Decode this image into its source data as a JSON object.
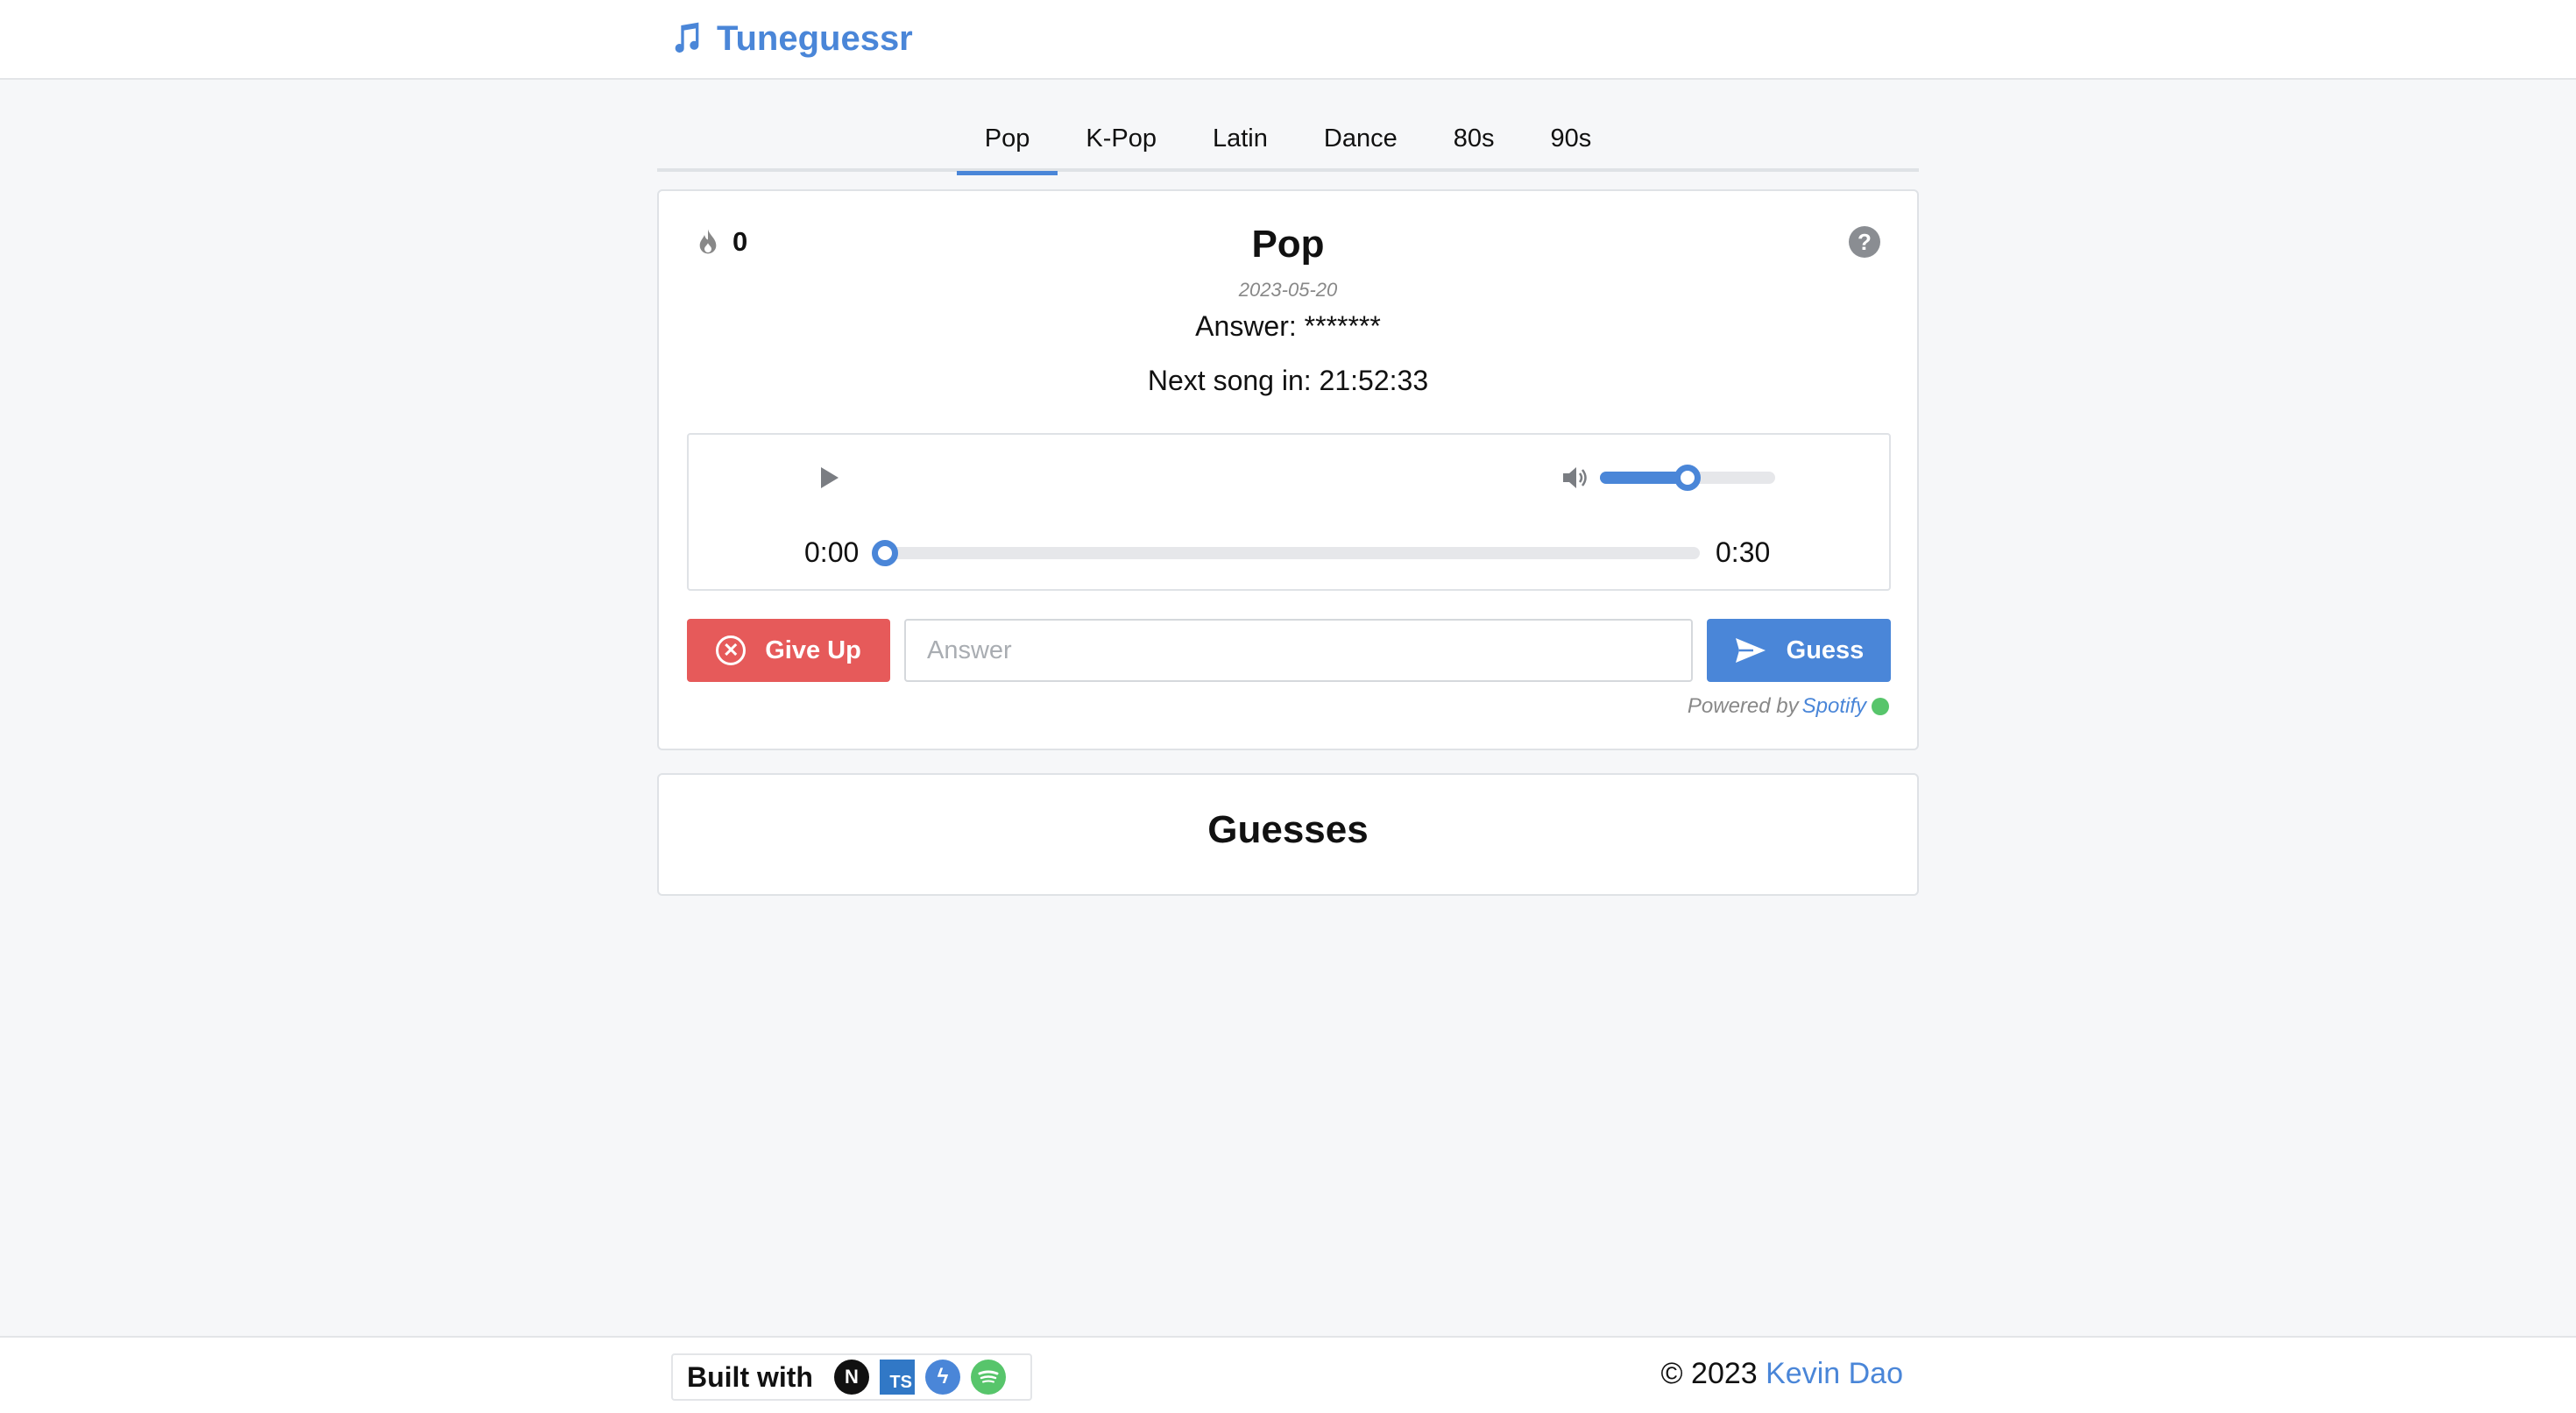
{
  "header": {
    "brand": "Tuneguessr",
    "brand_icon": "music-note-icon",
    "accent_color": "#4a86d8"
  },
  "tabs": [
    {
      "label": "Pop",
      "active": true
    },
    {
      "label": "K-Pop",
      "active": false
    },
    {
      "label": "Latin",
      "active": false
    },
    {
      "label": "Dance",
      "active": false
    },
    {
      "label": "80s",
      "active": false
    },
    {
      "label": "90s",
      "active": false
    }
  ],
  "game": {
    "streak": "0",
    "title": "Pop",
    "date": "2023-05-20",
    "answer_text": "Answer: *******",
    "next_song_text": "Next song in: 21:52:33",
    "help_icon": "?"
  },
  "player": {
    "current_time": "0:00",
    "duration": "0:30",
    "progress": 0.0,
    "volume": 0.5
  },
  "controls": {
    "give_up_label": "Give Up",
    "answer_placeholder": "Answer",
    "answer_value": "",
    "guess_label": "Guess",
    "give_up_color": "#e65a5a",
    "guess_color": "#4a86d8"
  },
  "powered_by": {
    "prefix": "Powered by",
    "service": "Spotify"
  },
  "guesses": {
    "title": "Guesses"
  },
  "footer": {
    "built_with_label": "Built with",
    "tech_icons": [
      {
        "name": "nextjs-icon",
        "glyph": "N"
      },
      {
        "name": "typescript-icon",
        "glyph": "TS"
      },
      {
        "name": "chakra-ui-icon",
        "glyph": "ϟ"
      },
      {
        "name": "spotify-icon",
        "glyph": ""
      }
    ],
    "copyright_prefix": "© 2023",
    "author": "Kevin Dao"
  }
}
